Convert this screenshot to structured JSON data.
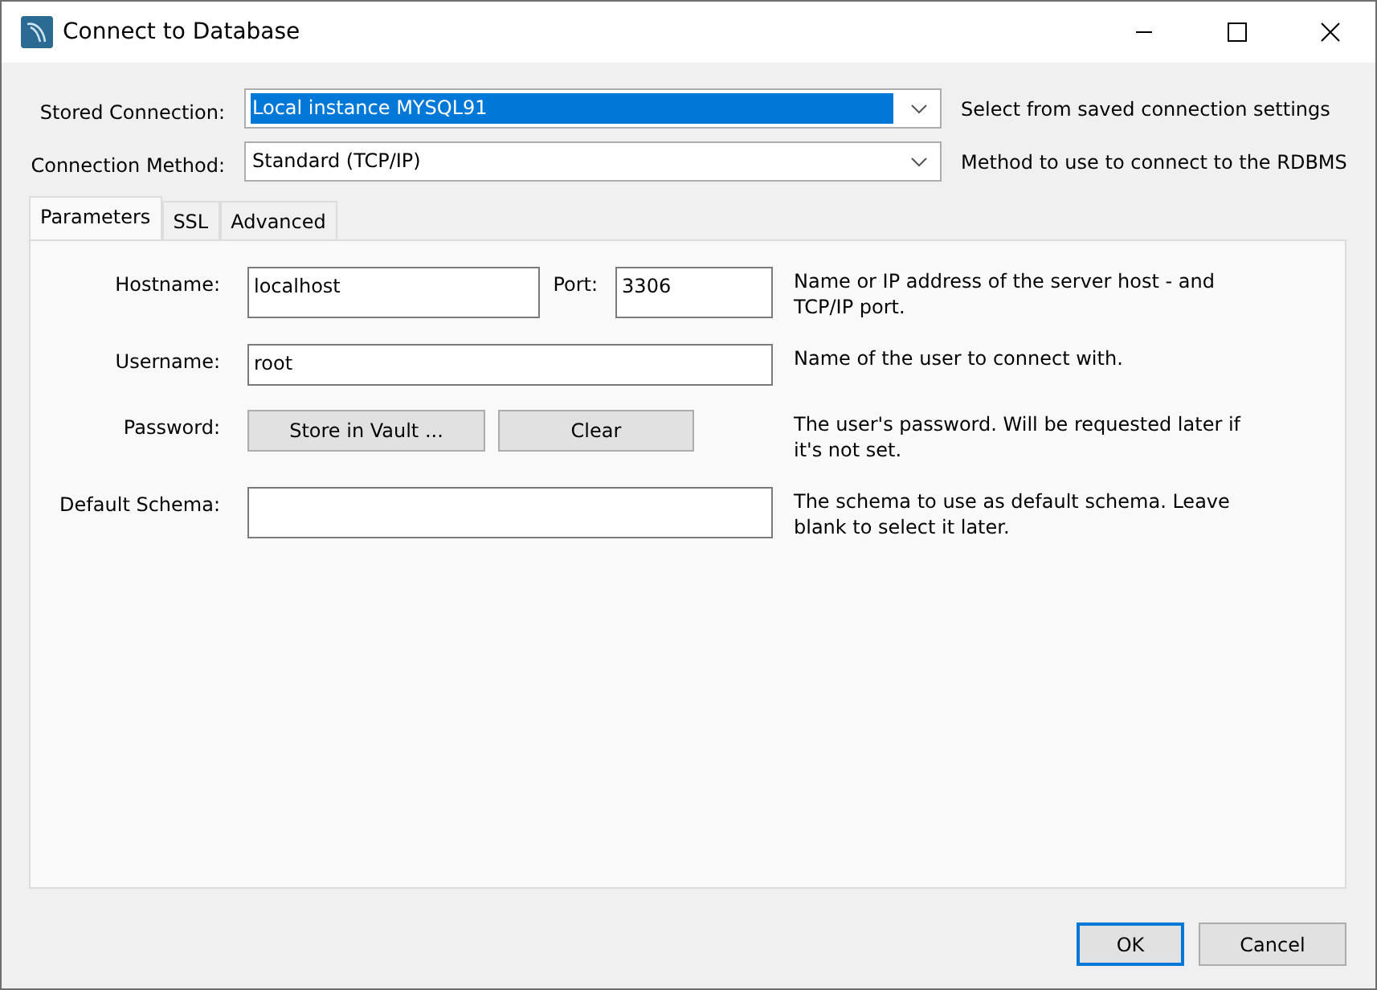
{
  "window": {
    "title": "Connect to Database"
  },
  "connection": [
    {
      "label": "Stored Connection:",
      "value": "Local instance MYSQL91",
      "highlighted": true,
      "hint": "Select from saved connection settings"
    },
    {
      "label": "Connection Method:",
      "value": "Standard (TCP/IP)",
      "highlighted": false,
      "hint": "Method to use to connect to the RDBMS"
    }
  ],
  "tabs": [
    {
      "label": "Parameters",
      "selected": true
    },
    {
      "label": "SSL",
      "selected": false
    },
    {
      "label": "Advanced",
      "selected": false
    }
  ],
  "parameters": [
    {
      "kind": "host",
      "label": "Hostname:",
      "value": "localhost",
      "port_label": "Port:",
      "port_value": "3306",
      "hint": "Name or IP address of the server host - and TCP/IP port."
    },
    {
      "kind": "text",
      "label": "Username:",
      "value": "root",
      "hint": "Name of the user to connect with."
    },
    {
      "kind": "buttons",
      "label": "Password:",
      "buttons": [
        "Store in Vault ...",
        "Clear"
      ],
      "hint": "The user's password. Will be requested later if it's not set."
    },
    {
      "kind": "tall",
      "label": "Default Schema:",
      "hint": "The schema to use as default schema. Leave blank to select it later."
    }
  ],
  "buttons": [
    {
      "label": "OK",
      "default": true
    },
    {
      "label": "Cancel",
      "default": false
    }
  ]
}
